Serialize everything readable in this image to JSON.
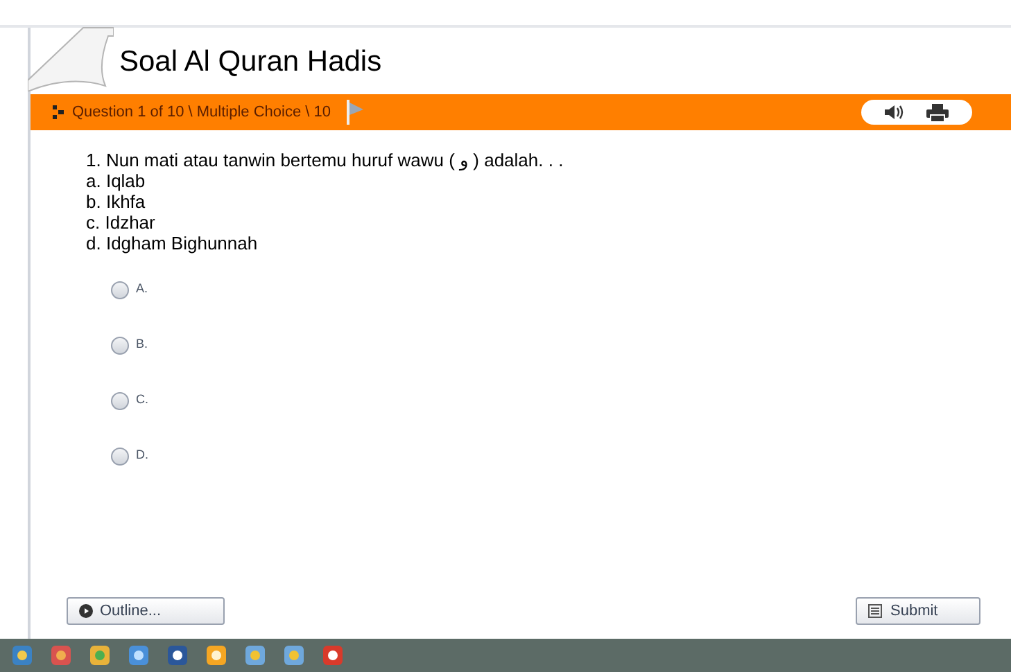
{
  "title": "Soal Al Quran Hadis",
  "question_bar": {
    "label": "Question 1 of 10 \\ Multiple Choice \\ 10"
  },
  "question": {
    "text": "1. Nun mati atau tanwin bertemu huruf wawu ( و ) adalah. . .",
    "choices": [
      "a. Iqlab",
      "b. Ikhfa",
      "c. Idzhar",
      "d. Idgham Bighunnah"
    ]
  },
  "options": [
    {
      "label": "A.",
      "selected": false
    },
    {
      "label": "B.",
      "selected": false
    },
    {
      "label": "C.",
      "selected": false
    },
    {
      "label": "D.",
      "selected": false
    }
  ],
  "buttons": {
    "outline": "Outline...",
    "submit": "Submit"
  }
}
